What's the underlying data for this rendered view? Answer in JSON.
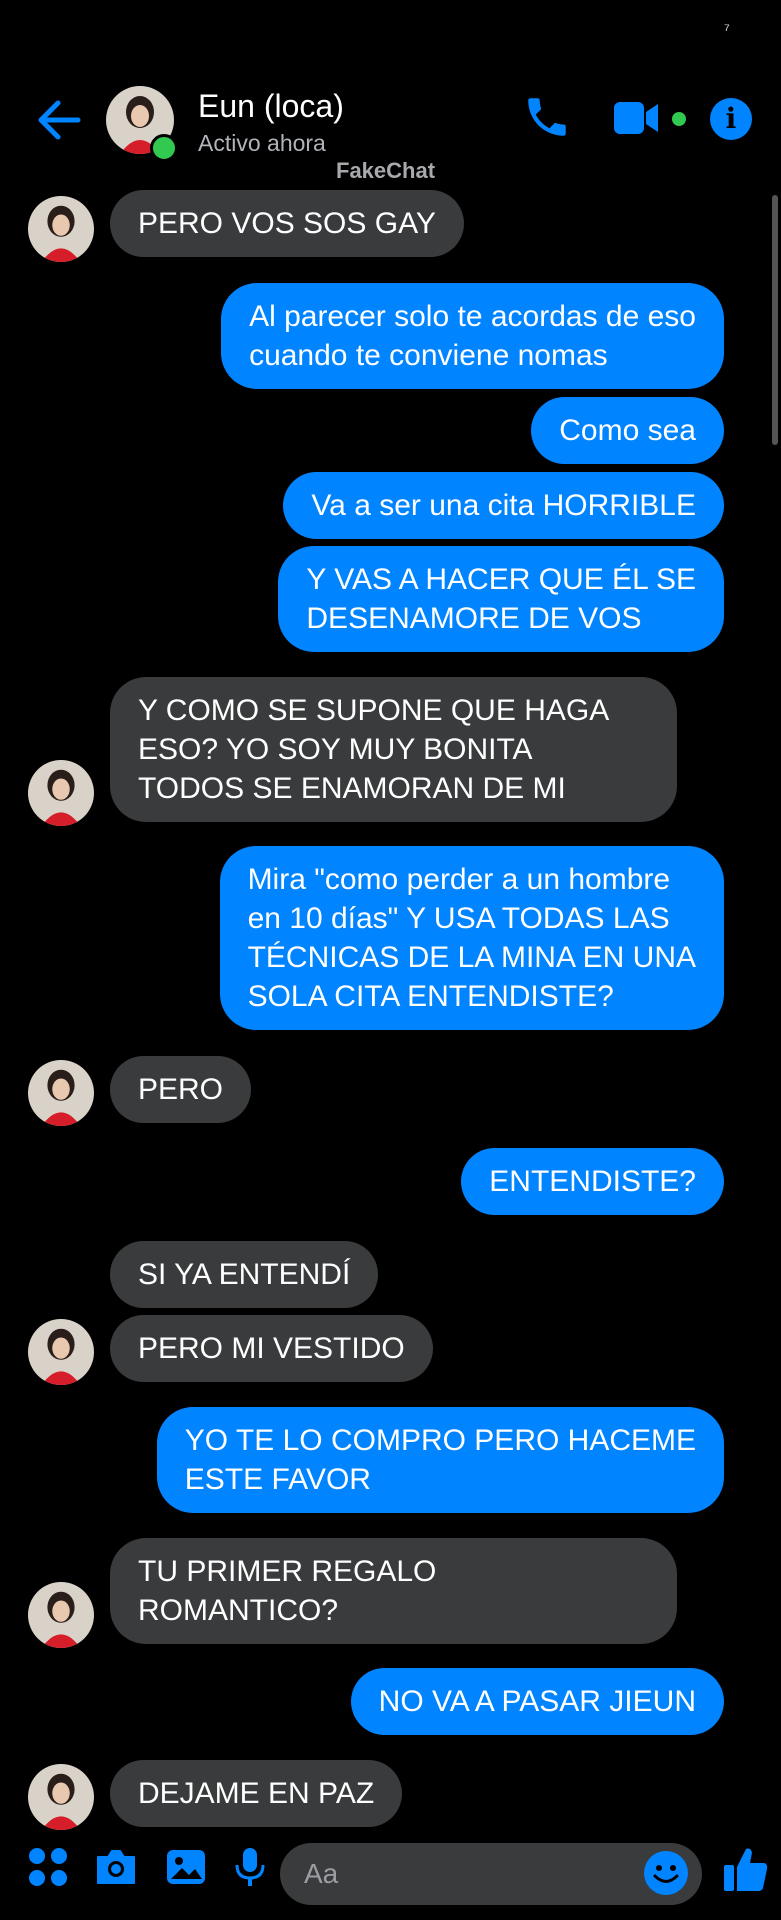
{
  "status_bar": {
    "glyph": "⁷"
  },
  "header": {
    "contact_name": "Eun (loca)",
    "contact_status": "Activo ahora",
    "watermark": "FakeChat",
    "icons": [
      "back-arrow-icon",
      "phone-icon",
      "video-camera-icon",
      "info-icon"
    ]
  },
  "colors": {
    "accent": "#0084ff",
    "incoming_bubble": "#3a3b3c",
    "online": "#31c950",
    "background": "#000000"
  },
  "messages": [
    {
      "from": "contact",
      "text": "PERO VOS SOS GAY"
    },
    {
      "from": "me",
      "text": "Al parecer solo te acordas de eso\ncuando te conviene nomas"
    },
    {
      "from": "me",
      "text": "Como sea"
    },
    {
      "from": "me",
      "text": "Va a ser una cita HORRIBLE"
    },
    {
      "from": "me",
      "text": "Y VAS A HACER QUE ÉL SE\nDESENAMORE DE VOS"
    },
    {
      "from": "contact",
      "text": "Y COMO SE SUPONE QUE HAGA\nESO? YO SOY MUY BONITA\nTODOS SE ENAMORAN DE MI"
    },
    {
      "from": "me",
      "text": "Mira \"como perder a un hombre\nen 10 días\" Y USA TODAS LAS\nTÉCNICAS DE LA MINA EN UNA\nSOLA CITA ENTENDISTE?"
    },
    {
      "from": "contact",
      "text": "PERO"
    },
    {
      "from": "me",
      "text": "ENTENDISTE?"
    },
    {
      "from": "contact",
      "text": "SI YA ENTENDÍ"
    },
    {
      "from": "contact",
      "text": "PERO MI VESTIDO"
    },
    {
      "from": "me",
      "text": "YO TE LO COMPRO PERO HACEME\nESTE FAVOR"
    },
    {
      "from": "contact",
      "text": "TU PRIMER REGALO\nROMANTICO?"
    },
    {
      "from": "me",
      "text": "NO VA A PASAR JIEUN"
    },
    {
      "from": "contact",
      "text": "DEJAME EN PAZ"
    }
  ],
  "composer": {
    "placeholder": "Aa",
    "icons": [
      "apps-grid-icon",
      "camera-icon",
      "gallery-icon",
      "microphone-icon",
      "emoji-icon",
      "thumbs-up-icon"
    ]
  }
}
